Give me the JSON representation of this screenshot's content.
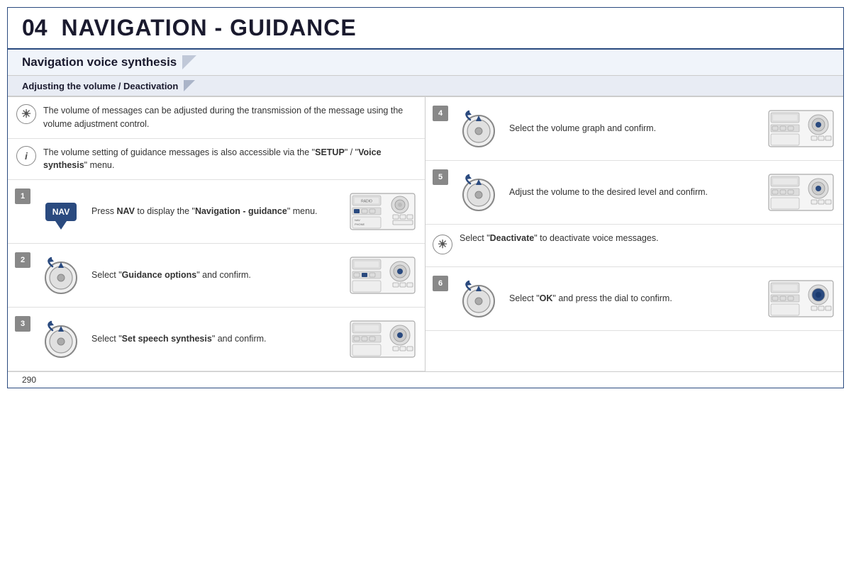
{
  "header": {
    "chapter_number": "04",
    "title": "NAVIGATION - GUIDANCE"
  },
  "section": {
    "title": "Navigation voice synthesis"
  },
  "subsection": {
    "title": "Adjusting the volume / Deactivation"
  },
  "info_blocks": [
    {
      "icon": "☀",
      "text": "The volume of messages can be adjusted during the transmission of the message using the volume adjustment control."
    },
    {
      "icon": "i",
      "text_plain": "The volume setting of guidance messages is also accessible via the \"",
      "bold1": "SETUP",
      "text_mid": "\" / \"",
      "bold2": "Voice synthesis",
      "text_end": "\" menu."
    }
  ],
  "left_steps": [
    {
      "number": "1",
      "desc_plain": "Press ",
      "bold": "NAV",
      "desc_end": " to display the \"",
      "bold2": "Navigation - guidance",
      "desc_end2": "\" menu."
    },
    {
      "number": "2",
      "desc_plain": "Select \"",
      "bold": "Guidance options",
      "desc_end": "\" and confirm."
    },
    {
      "number": "3",
      "desc_plain": "Select \"",
      "bold": "Set speech synthesis",
      "desc_end": "\" and confirm."
    }
  ],
  "right_steps": [
    {
      "number": "4",
      "desc_plain": "Select the volume graph and confirm."
    },
    {
      "number": "5",
      "desc_plain": "Adjust the volume to the desired level and confirm."
    },
    {
      "number": "sun",
      "desc_plain": "Select \"",
      "bold": "Deactivate",
      "desc_end": "\" to deactivate voice messages."
    },
    {
      "number": "6",
      "desc_plain": "Select \"",
      "bold": "OK",
      "desc_end": "\" and press the dial to confirm."
    }
  ],
  "footer": {
    "page_number": "290"
  }
}
